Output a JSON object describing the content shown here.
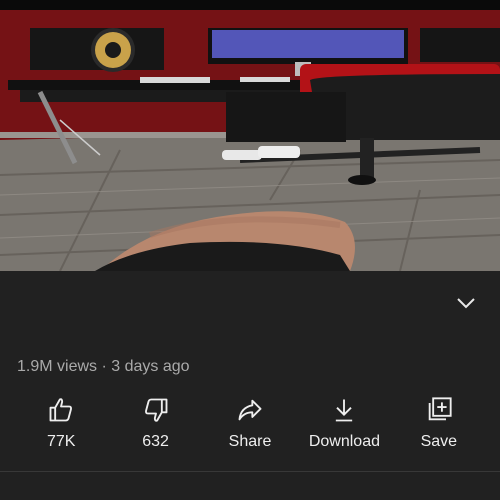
{
  "video": {
    "thumbnail": "studio-desk-knee-frame"
  },
  "meta": {
    "views": "1.9M views",
    "separator": " · ",
    "age": "3 days ago"
  },
  "actions": {
    "like": {
      "label": "77K",
      "icon": "thumbs-up-icon"
    },
    "dislike": {
      "label": "632",
      "icon": "thumbs-down-icon"
    },
    "share": {
      "label": "Share",
      "icon": "share-icon"
    },
    "download": {
      "label": "Download",
      "icon": "download-icon"
    },
    "save": {
      "label": "Save",
      "icon": "save-to-playlist-icon"
    }
  },
  "colors": {
    "background": "#212121",
    "text": "#eeeeee",
    "secondary_text": "#aaaaaa"
  }
}
